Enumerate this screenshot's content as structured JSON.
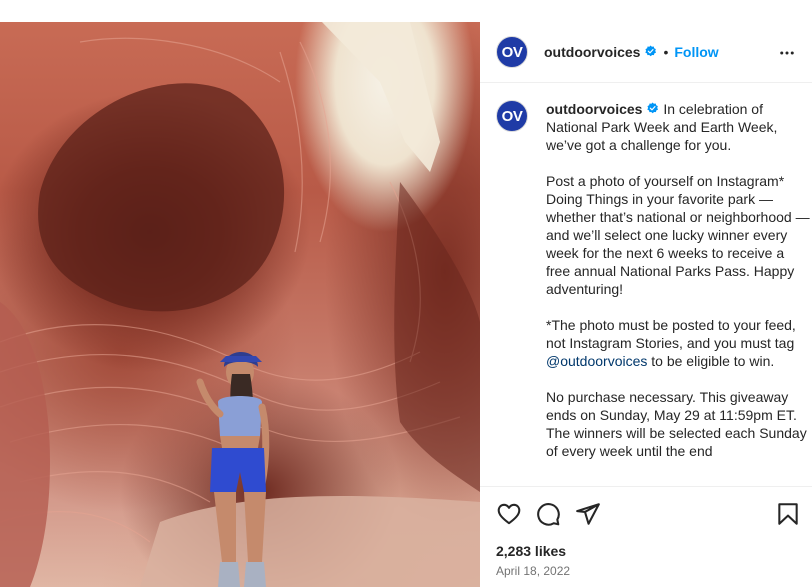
{
  "post": {
    "username": "outdoorvoices",
    "avatar_text": "OV",
    "follow_label": "Follow",
    "separator": "•",
    "caption_paragraphs": [
      "In celebration of National Park Week and Earth Week, we’ve got a challenge for you.",
      "Post a photo of yourself on Instagram* Doing Things in your favorite park — whether that’s national or neighborhood — and we’ll select one lucky winner every week for the next 6 weeks to receive a free annual National Parks Pass. Happy adventuring!",
      "No purchase necessary. This giveaway ends on Sunday, May 29 at 11:59pm ET. The winners will be selected each Sunday of every week until the end"
    ],
    "fine_print_before": "*The photo must be posted to your feed, not Instagram Stories, and you must tag ",
    "fine_print_mention": "@outdoorvoices",
    "fine_print_after": " to be eligible to win.",
    "likes": "2,283 likes",
    "date": "April 18, 2022"
  },
  "icons": {
    "verified": "verified-badge-icon",
    "more": "more-options-icon",
    "like": "heart-icon",
    "comment": "comment-icon",
    "share": "share-icon",
    "save": "bookmark-icon"
  },
  "colors": {
    "accent": "#0095f6",
    "avatar_bg": "#1f3ba6",
    "verified": "#0095f6",
    "mention": "#00376b",
    "text": "#262626",
    "muted": "#737373"
  }
}
